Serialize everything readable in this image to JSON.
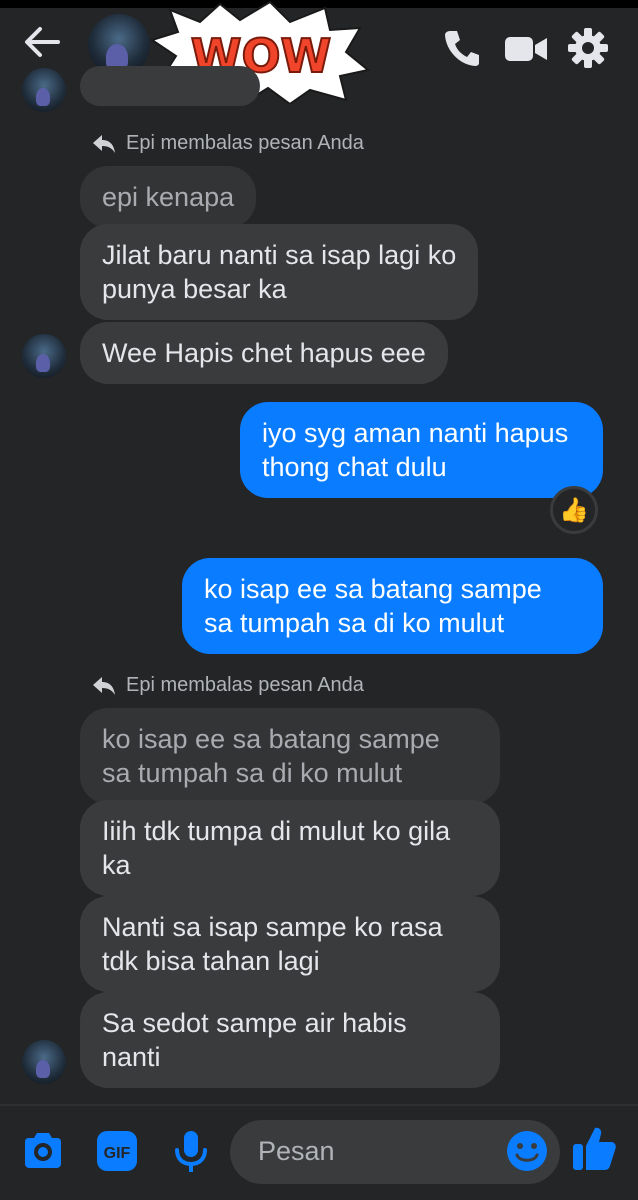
{
  "header": {
    "back_icon": "arrow-left-icon",
    "wow_sticker": "WOW",
    "actions": [
      "phone-icon",
      "video-camera-icon",
      "gear-icon"
    ]
  },
  "messages": {
    "reply_note_1": "Epi membalas pesan Anda",
    "quote_1": "epi kenapa",
    "msg_1": [
      "Jilat baru nanti sa isap lagi ko",
      "punya besar ka"
    ],
    "msg_2": "Wee Hapis chet hapus eee",
    "out_1": [
      "iyo syg aman nanti hapus",
      "thong chat dulu"
    ],
    "reaction_1": "👍",
    "out_2": [
      "ko isap ee sa batang sampe",
      "sa tumpah sa di ko mulut"
    ],
    "reply_note_2": "Epi membalas pesan Anda",
    "quote_2": [
      "ko isap ee sa batang sampe",
      "sa tumpah sa di ko mulut"
    ],
    "msg_3": [
      "Iiih tdk tumpa di mulut ko gila",
      "ka"
    ],
    "msg_4": [
      "Nanti sa isap sampe ko rasa",
      "tdk bisa tahan lagi"
    ],
    "msg_5": [
      "Sa sedot sampe air habis",
      "nanti"
    ]
  },
  "composer": {
    "placeholder": "Pesan",
    "gif_label": "GIF",
    "icons": [
      "camera-icon",
      "gif-icon",
      "microphone-icon",
      "emoji-icon",
      "thumbs-up-icon"
    ]
  },
  "colors": {
    "accent": "#0a7cff",
    "bubble_in": "#3a3b3d",
    "background": "#242527"
  }
}
